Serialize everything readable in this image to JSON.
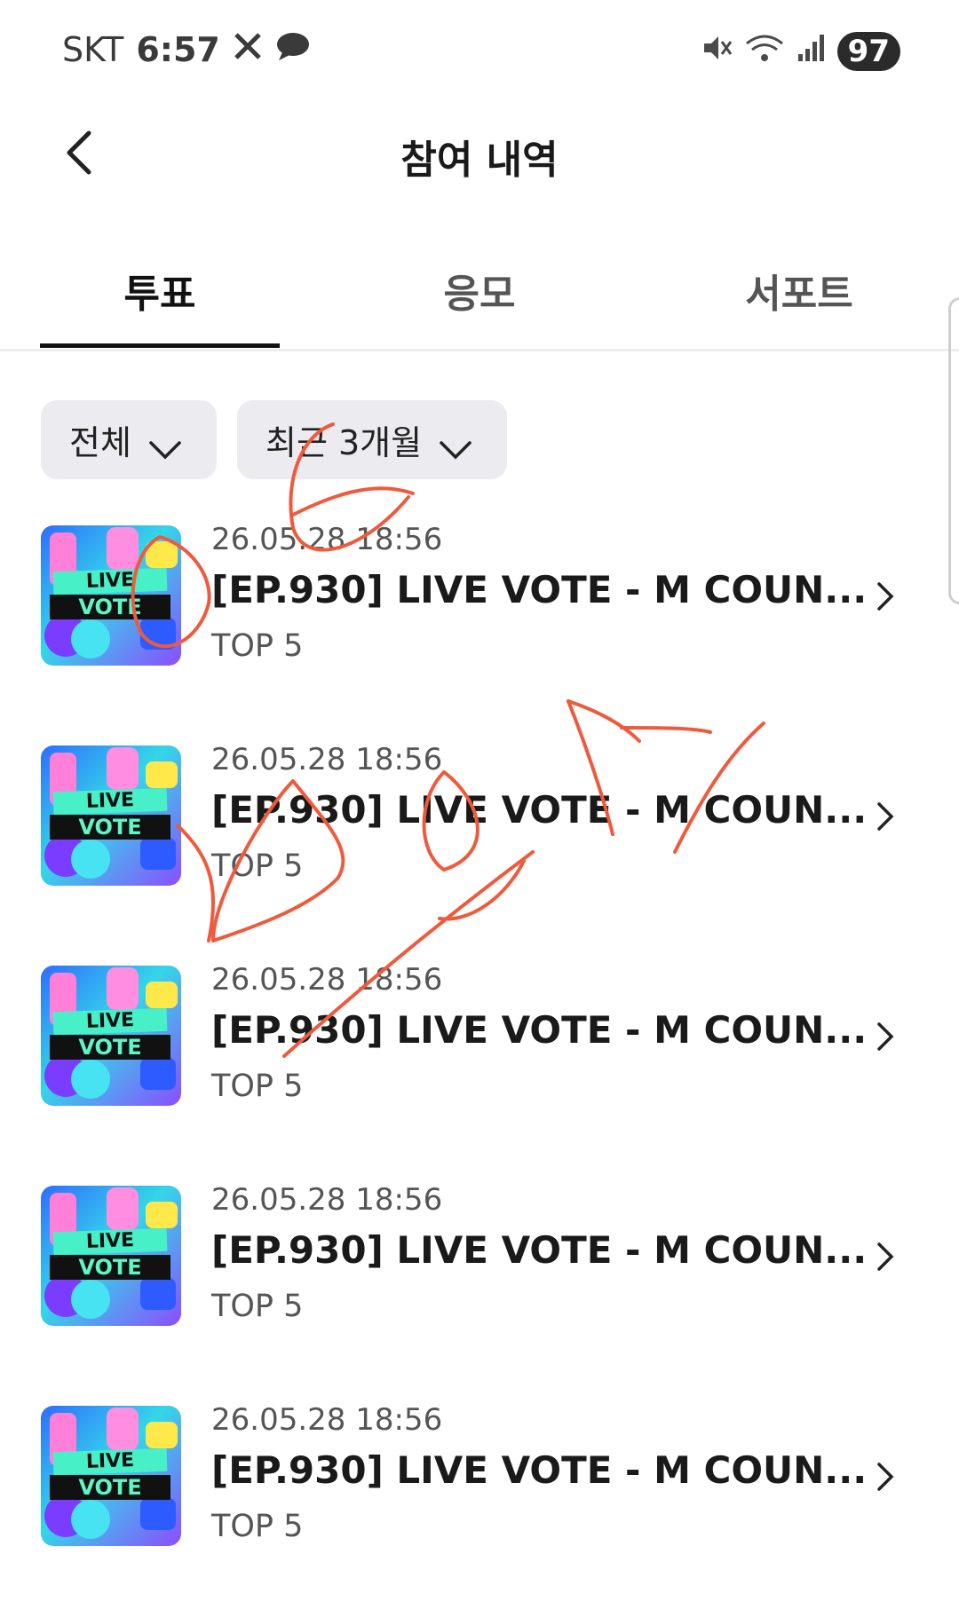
{
  "status_bar": {
    "carrier": "SKT",
    "time": "6:57",
    "battery": "97",
    "icons": [
      "x-logo-icon",
      "chat-bubble-icon",
      "mute-icon",
      "wifi-icon",
      "signal-icon"
    ]
  },
  "header": {
    "title": "참여 내역",
    "back_icon": "back-arrow-icon"
  },
  "tabs": [
    {
      "label": "투표",
      "active": true
    },
    {
      "label": "응모",
      "active": false
    },
    {
      "label": "서포트",
      "active": false
    }
  ],
  "filters": {
    "category": "전체",
    "period": "최근 3개월"
  },
  "items": [
    {
      "date": "26.05.28 18:56",
      "title": "[EP.930] LIVE VOTE - M COUN...",
      "subtitle": "TOP 5",
      "thumb_live": "LIVE",
      "thumb_vote": "VOTE"
    },
    {
      "date": "26.05.28 18:56",
      "title": "[EP.930] LIVE VOTE - M COUN...",
      "subtitle": "TOP 5",
      "thumb_live": "LIVE",
      "thumb_vote": "VOTE"
    },
    {
      "date": "26.05.28 18:56",
      "title": "[EP.930] LIVE VOTE - M COUN...",
      "subtitle": "TOP 5",
      "thumb_live": "LIVE",
      "thumb_vote": "VOTE"
    },
    {
      "date": "26.05.28 18:56",
      "title": "[EP.930] LIVE VOTE - M COUN...",
      "subtitle": "TOP 5",
      "thumb_live": "LIVE",
      "thumb_vote": "VOTE"
    },
    {
      "date": "26.05.28 18:56",
      "title": "[EP.930] LIVE VOTE - M COUN...",
      "subtitle": "TOP 5",
      "thumb_live": "LIVE",
      "thumb_vote": "VOTE"
    }
  ],
  "colors": {
    "accent_text": "#111111",
    "filter_bg": "#ececf0",
    "scribble": "#f05a3c"
  }
}
